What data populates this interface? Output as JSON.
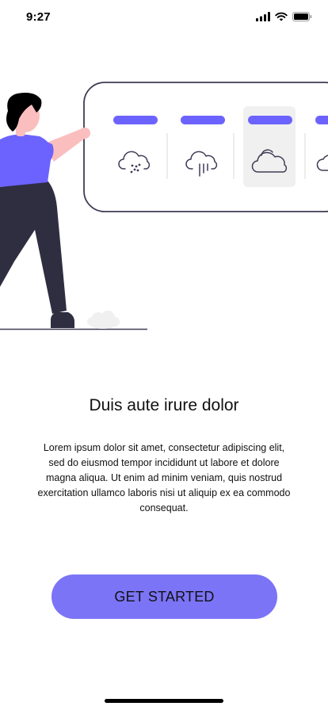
{
  "status_bar": {
    "time": "9:27",
    "icons": [
      "signal-icon",
      "wifi-icon",
      "battery-icon"
    ]
  },
  "illustration": {
    "weather_icons": [
      "hail-cloud-icon",
      "rain-cloud-icon",
      "cloudy-icon",
      "cloud-icon"
    ],
    "selected_index": 2,
    "accent_color": "#6c63ff"
  },
  "onboarding": {
    "title": "Duis aute irure dolor",
    "description": "Lorem ipsum dolor sit amet, consectetur adipiscing elit, sed do eiusmod tempor incididunt ut labore et dolore magna aliqua. Ut enim ad minim veniam, quis nostrud exercitation ullamco laboris nisi ut aliquip ex ea commodo consequat.",
    "button_label": "GET STARTED",
    "button_color": "#7b74f6"
  }
}
